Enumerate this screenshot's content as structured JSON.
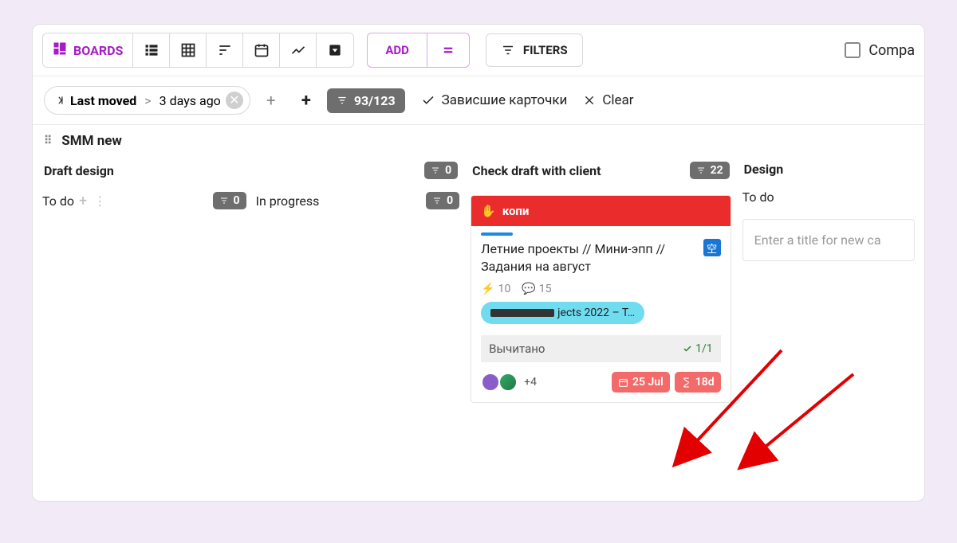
{
  "toolbar": {
    "boards_label": "BOARDS",
    "add_label": "ADD",
    "filters_label": "FILTERS",
    "compare_label": "Compa"
  },
  "filterrow": {
    "chip_field": "Last moved",
    "chip_value": "3 days ago",
    "count": "93/123",
    "saved_filter": "Зависшие карточки",
    "clear": "Clear"
  },
  "board": {
    "name": "SMM new"
  },
  "columns": {
    "draft": {
      "title": "Draft design",
      "count": "0",
      "sub_todo": {
        "title": "To do",
        "count": "0"
      },
      "sub_inprogress": {
        "title": "In progress",
        "count": "0"
      }
    },
    "check": {
      "title": "Check draft with client",
      "count": "22"
    },
    "design": {
      "title": "Design",
      "sub_todo": {
        "title": "To do"
      },
      "newcard_placeholder": "Enter a title for new ca"
    }
  },
  "card": {
    "label": "копи",
    "title": "Летние проекты // Мини-эпп // Задания на август",
    "effort": "10",
    "comments": "15",
    "tag_suffix": "jects 2022 – T…",
    "checklist_label": "Вычитано",
    "checklist_stat": "1/1",
    "avatars_more": "+4",
    "date": "25 Jul",
    "age": "18d"
  }
}
